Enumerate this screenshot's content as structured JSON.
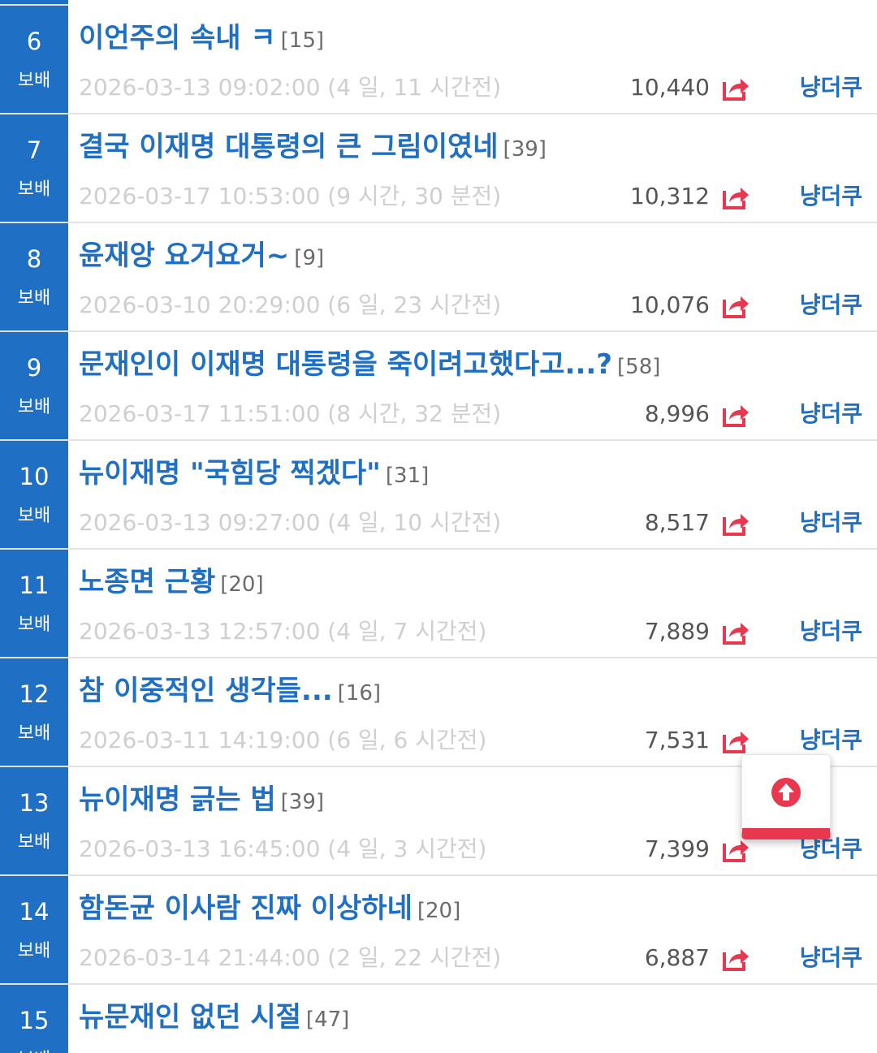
{
  "rank_label": "보배",
  "colors": {
    "brand_blue": "#1f6fc5",
    "share_red": "#e8384f",
    "muted_gray": "#cfcfcf"
  },
  "posts": [
    {
      "rank": "6",
      "title": "이언주의 속내 ㅋ",
      "comments": "[15]",
      "datetime": "2026-03-13 09:02:00 (4 일, 11 시간전)",
      "views": "10,440",
      "author": "냥더쿠"
    },
    {
      "rank": "7",
      "title": "결국 이재명 대통령의 큰 그림이였네",
      "comments": "[39]",
      "datetime": "2026-03-17 10:53:00 (9 시간, 30 분전)",
      "views": "10,312",
      "author": "냥더쿠"
    },
    {
      "rank": "8",
      "title": "윤재앙 요거요거~",
      "comments": "[9]",
      "datetime": "2026-03-10 20:29:00 (6 일, 23 시간전)",
      "views": "10,076",
      "author": "냥더쿠"
    },
    {
      "rank": "9",
      "title": "문재인이 이재명 대통령을 죽이려고했다고...?",
      "comments": "[58]",
      "datetime": "2026-03-17 11:51:00 (8 시간, 32 분전)",
      "views": "8,996",
      "author": "냥더쿠"
    },
    {
      "rank": "10",
      "title": "뉴이재명 \"국힘당 찍겠다\"",
      "comments": "[31]",
      "datetime": "2026-03-13 09:27:00 (4 일, 10 시간전)",
      "views": "8,517",
      "author": "냥더쿠"
    },
    {
      "rank": "11",
      "title": "노종면 근황",
      "comments": "[20]",
      "datetime": "2026-03-13 12:57:00 (4 일, 7 시간전)",
      "views": "7,889",
      "author": "냥더쿠"
    },
    {
      "rank": "12",
      "title": "참 이중적인 생각들...",
      "comments": "[16]",
      "datetime": "2026-03-11 14:19:00 (6 일, 6 시간전)",
      "views": "7,531",
      "author": "냥더쿠"
    },
    {
      "rank": "13",
      "title": "뉴이재명 긁는 법",
      "comments": "[39]",
      "datetime": "2026-03-13 16:45:00 (4 일, 3 시간전)",
      "views": "7,399",
      "author": "냥더쿠"
    },
    {
      "rank": "14",
      "title": "함돈균 이사람 진짜 이상하네",
      "comments": "[20]",
      "datetime": "2026-03-14 21:44:00 (2 일, 22 시간전)",
      "views": "6,887",
      "author": "냥더쿠"
    },
    {
      "rank": "15",
      "title": "뉴문재인 없던 시절",
      "comments": "[47]",
      "datetime": "",
      "views": "",
      "author": ""
    }
  ],
  "scroll_top": {
    "icon": "arrow-up-circle-icon"
  }
}
